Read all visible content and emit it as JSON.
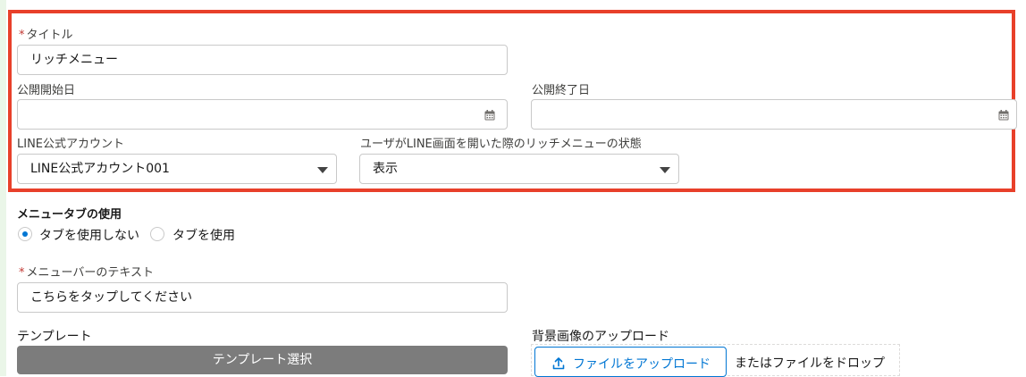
{
  "form": {
    "top_partial_title": "",
    "title": {
      "label": "タイトル",
      "required": "*",
      "value": "リッチメニュー"
    },
    "publish_start": {
      "label": "公開開始日",
      "value": ""
    },
    "publish_end": {
      "label": "公開終了日",
      "value": ""
    },
    "line_account": {
      "label": "LINE公式アカウント",
      "selected": "LINE公式アカウント001"
    },
    "menu_state": {
      "label": "ユーザがLINE画面を開いた際のリッチメニューの状態",
      "selected": "表示"
    },
    "menu_tab": {
      "label": "メニュータブの使用",
      "options": [
        "タブを使用しない",
        "タブを使用"
      ],
      "selected_index": 0
    },
    "menu_bar_text": {
      "label": "メニューバーのテキスト",
      "required": "*",
      "value": "こちらをタップしてください"
    },
    "template": {
      "label": "テンプレート",
      "button": "テンプレート選択"
    },
    "background_upload": {
      "label": "背景画像のアップロード",
      "button": "ファイルをアップロード",
      "drop_text": "またはファイルをドロップ"
    }
  },
  "colors": {
    "highlight_border": "#e8402a",
    "accent": "#0176d3",
    "required": "#c23934",
    "template_button": "#7c7c7c"
  },
  "icons": {
    "date": "calendar-icon",
    "select": "chevron-down-icon",
    "upload": "upload-icon"
  }
}
